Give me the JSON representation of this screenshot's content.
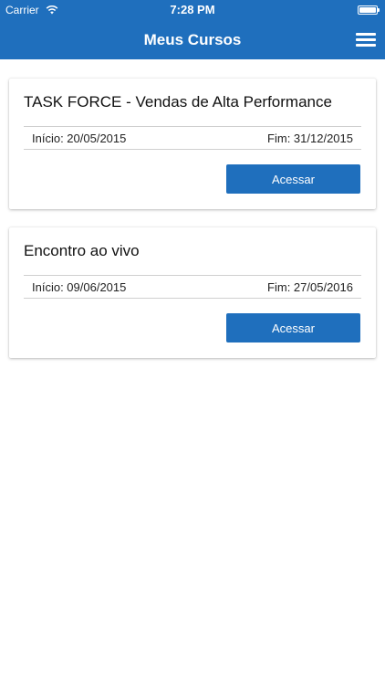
{
  "status_bar": {
    "carrier": "Carrier",
    "time": "7:28 PM",
    "icons": [
      "wifi-icon",
      "battery-icon"
    ]
  },
  "header": {
    "title": "Meus Cursos",
    "menu_icon": "hamburger-menu-icon",
    "background_color": "#1f6fbd"
  },
  "courses": [
    {
      "name": "TASK FORCE - Vendas de Alta Performance",
      "start": "Início: 20/05/2015",
      "end": "Fim: 31/12/2015",
      "button_label": "Acessar"
    },
    {
      "name": "Encontro ao vivo",
      "start": "Início: 09/06/2015",
      "end": "Fim: 27/05/2016",
      "button_label": "Acessar"
    }
  ]
}
